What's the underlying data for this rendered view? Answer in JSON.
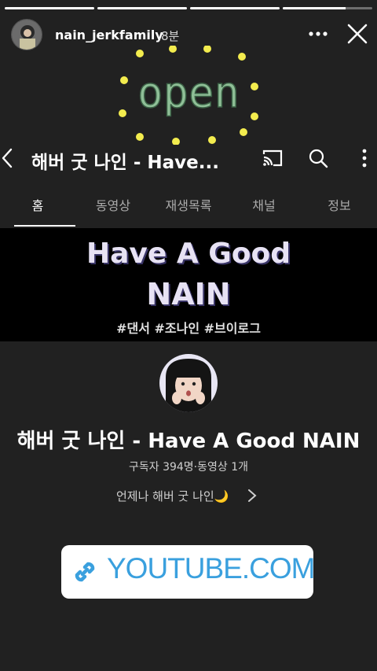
{
  "story": {
    "progress": [
      1,
      1,
      1,
      0.7
    ],
    "username": "nain_jerkfamily",
    "time_ago": "8분"
  },
  "sticker": {
    "open_text": "open"
  },
  "youtube": {
    "header_title": "해버 굿 나인 - Have...",
    "tabs": [
      {
        "label": "홈",
        "active": true
      },
      {
        "label": "동영상",
        "active": false
      },
      {
        "label": "재생목록",
        "active": false
      },
      {
        "label": "채널",
        "active": false
      },
      {
        "label": "정보",
        "active": false
      }
    ],
    "banner": {
      "line1": "Have A Good",
      "line2": "NAIN",
      "tags": "#댄서  #조나인  #브이로그"
    },
    "channel": {
      "name": "해버 굿 나인 - Have A Good NAIN",
      "stats": "구독자 394명·동영상 1개",
      "description": "언제나 해버 굿 나인🌙"
    }
  },
  "link_sticker": {
    "text": "YOUTUBE.COM"
  },
  "colors": {
    "background": "#212121",
    "link_blue": "#3aa0de",
    "sticker_yellow": "#f3ec4e",
    "sticker_green": "#8fbf97"
  }
}
